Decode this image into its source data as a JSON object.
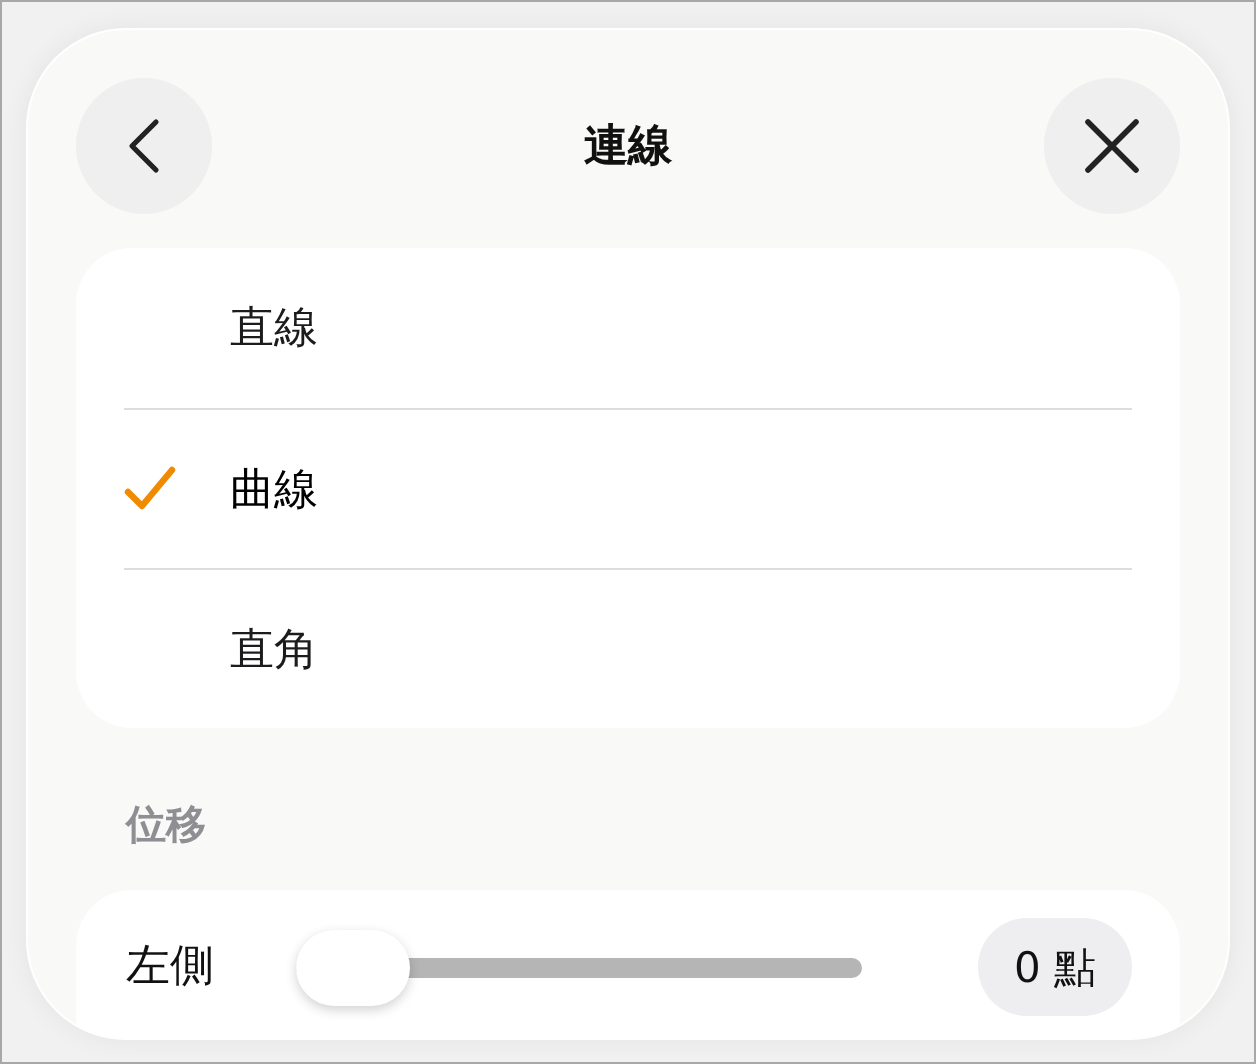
{
  "header": {
    "title": "連線"
  },
  "options": [
    {
      "label": "直線",
      "selected": false
    },
    {
      "label": "曲線",
      "selected": true
    },
    {
      "label": "直角",
      "selected": false
    }
  ],
  "offset": {
    "section_title": "位移",
    "label": "左側",
    "level": 0,
    "value": "0 點"
  }
}
